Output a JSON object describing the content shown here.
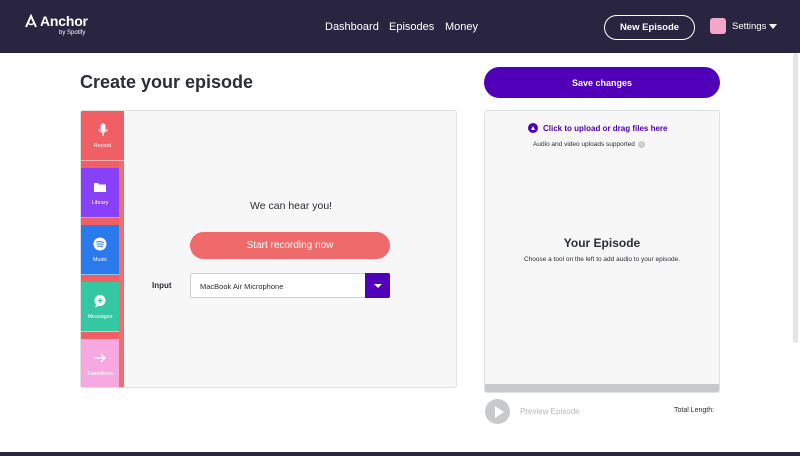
{
  "brand": {
    "name": "Anchor",
    "sub": "by Spotify"
  },
  "nav": {
    "items": [
      "Dashboard",
      "Episodes",
      "Money"
    ]
  },
  "header": {
    "new_episode": "New Episode",
    "settings": "Settings"
  },
  "page": {
    "title": "Create your episode",
    "save": "Save changes"
  },
  "tools": [
    {
      "label": "Record",
      "icon": "microphone-icon"
    },
    {
      "label": "Library",
      "icon": "folder-icon"
    },
    {
      "label": "Music",
      "icon": "spotify-icon"
    },
    {
      "label": "Messages",
      "icon": "message-icon"
    },
    {
      "label": "Transitions",
      "icon": "arrow-right-icon"
    }
  ],
  "recorder": {
    "status": "We can hear you!",
    "start": "Start recording now",
    "input_label": "Input",
    "input_value": "MacBook Air Microphone"
  },
  "episode": {
    "upload": "Click to upload or drag files here",
    "upload_sub": "Audio and video uploads supported",
    "title": "Your Episode",
    "desc": "Choose a tool on the left to add audio to your episode.",
    "preview": "Preview Episode",
    "total_length": "Total Length:"
  },
  "colors": {
    "nav_bg": "#292541",
    "accent": "#5000b9",
    "record": "#ef5f64",
    "library": "#8940fa",
    "music": "#2b7aed",
    "messages": "#35c7a1",
    "transitions": "#f7a8e0"
  }
}
